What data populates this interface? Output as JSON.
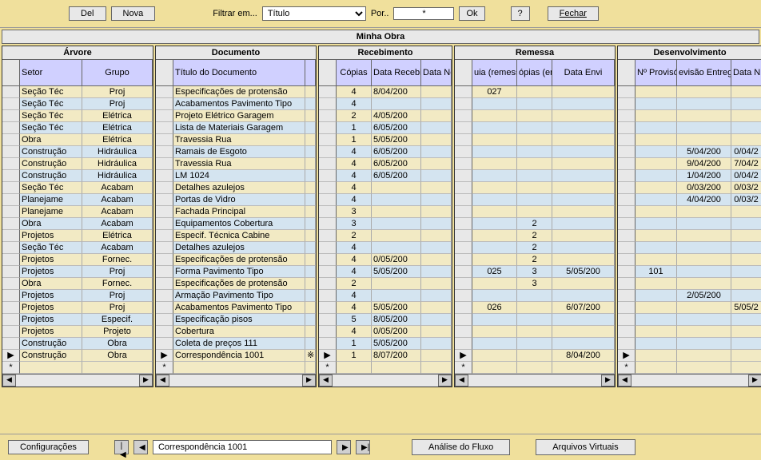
{
  "toolbar": {
    "del": "Del",
    "nova": "Nova",
    "filtrar_lbl": "Filtrar em...",
    "filtrar_sel": "Título",
    "por_lbl": "Por..",
    "por_val": "*",
    "ok": "Ok",
    "help": "?",
    "fechar": "Fechar"
  },
  "app_title": "Minha Obra",
  "panels": {
    "arvore": "Árvore",
    "documento": "Documento",
    "recebimento": "Recebimento",
    "remessa": "Remessa",
    "desenvolvimento": "Desenvolvimento"
  },
  "headers": {
    "arvore": [
      "",
      "Setor",
      "Grupo"
    ],
    "documento": [
      "",
      "Título do Documento",
      ""
    ],
    "recebimento": [
      "",
      "Cópias",
      "Data Recebim",
      "Data Ne"
    ],
    "remessa": [
      "",
      "uia (remessa",
      "ópias (en",
      "Data Envi"
    ],
    "desenvolvimento": [
      "",
      "Nº Provisóri",
      "evisão Entreg",
      "Data N"
    ]
  },
  "rows": [
    {
      "setor": "Seção Téc",
      "grupo": "Proj",
      "doc": "Especificações de protensão",
      "copias": "4",
      "drec": "8/04/200",
      "guia": "027"
    },
    {
      "setor": "Seção Téc",
      "grupo": "Proj",
      "doc": "Acabamentos Pavimento Tipo",
      "copias": "4"
    },
    {
      "setor": "Seção Téc",
      "grupo": "Elétrica",
      "doc": "Projeto Elétrico Garagem",
      "copias": "2",
      "drec": "4/05/200"
    },
    {
      "setor": "Seção Téc",
      "grupo": "Elétrica",
      "doc": "Lista de Materiais Garagem",
      "copias": "1",
      "drec": "6/05/200"
    },
    {
      "setor": "Obra",
      "grupo": "Elétrica",
      "doc": "Travessia Rua",
      "copias": "1",
      "drec": "5/05/200"
    },
    {
      "setor": "Construção",
      "grupo": "Hidráulica",
      "doc": "Ramais de Esgoto",
      "copias": "4",
      "drec": "6/05/200",
      "prev": "5/04/200",
      "dtn": "0/04/2"
    },
    {
      "setor": "Construção",
      "grupo": "Hidráulica",
      "doc": "Travessia Rua",
      "copias": "4",
      "drec": "6/05/200",
      "prev": "9/04/200",
      "dtn": "7/04/2"
    },
    {
      "setor": "Construção",
      "grupo": "Hidráulica",
      "doc": "LM 1024",
      "copias": "4",
      "drec": "6/05/200",
      "prev": "1/04/200",
      "dtn": "0/04/2"
    },
    {
      "setor": "Seção Téc",
      "grupo": "Acabam",
      "doc": "Detalhes azulejos",
      "copias": "4",
      "prev": "0/03/200",
      "dtn": "0/03/2"
    },
    {
      "setor": "Planejame",
      "grupo": "Acabam",
      "doc": "Portas de Vidro",
      "copias": "4",
      "prev": "4/04/200",
      "dtn": "0/03/2"
    },
    {
      "setor": "Planejame",
      "grupo": "Acabam",
      "doc": "Fachada Principal",
      "copias": "3"
    },
    {
      "setor": "Obra",
      "grupo": "Acabam",
      "doc": "Equipamentos Cobertura",
      "copias": "3",
      "copen": "2"
    },
    {
      "setor": "Projetos",
      "grupo": "Elétrica",
      "doc": "Especif. Técnica Cabine",
      "copias": "2",
      "copen": "2"
    },
    {
      "setor": "Seção Téc",
      "grupo": "Acabam",
      "doc": "Detalhes azulejos",
      "copias": "4",
      "copen": "2"
    },
    {
      "setor": "Projetos",
      "grupo": "Fornec.",
      "doc": "Especificações de protensão",
      "copias": "4",
      "drec": "0/05/200",
      "copen": "2"
    },
    {
      "setor": "Projetos",
      "grupo": "Proj",
      "doc": "Forma Pavimento Tipo",
      "copias": "4",
      "drec": "5/05/200",
      "guia": "025",
      "copen": "3",
      "denv": "5/05/200",
      "nprov": "101"
    },
    {
      "setor": "Obra",
      "grupo": "Fornec.",
      "doc": "Especificações de protensão",
      "copias": "2",
      "copen": "3"
    },
    {
      "setor": "Projetos",
      "grupo": "Proj",
      "doc": "Armação Pavimento Tipo",
      "copias": "4",
      "prev": "2/05/200"
    },
    {
      "setor": "Projetos",
      "grupo": "Proj",
      "doc": "Acabamentos Pavimento Tipo",
      "copias": "4",
      "drec": "5/05/200",
      "guia": "026",
      "denv": "6/07/200",
      "dtn": "5/05/2"
    },
    {
      "setor": "Projetos",
      "grupo": "Especif.",
      "doc": "Especificação pisos",
      "copias": "5",
      "drec": "8/05/200"
    },
    {
      "setor": "Projetos",
      "grupo": "Projeto",
      "doc": "Cobertura",
      "copias": "4",
      "drec": "0/05/200"
    },
    {
      "setor": "Construção",
      "grupo": "Obra",
      "doc": "Coleta de preços 111",
      "copias": "1",
      "drec": "5/05/200"
    },
    {
      "setor": "Construção",
      "grupo": "Obra",
      "doc": "Correspondência 1001",
      "copias": "1",
      "drec": "8/07/200",
      "denv": "8/04/200",
      "active": true,
      "docx": "※"
    }
  ],
  "footer": {
    "config": "Configurações",
    "record": "Correspondência 1001",
    "analise": "Análise do Fluxo",
    "arquivos": "Arquivos Virtuais"
  },
  "glyph": {
    "play": "▶",
    "star": "*",
    "left": "◀",
    "right": "▶",
    "first": "|◀",
    "last": "▶|"
  }
}
